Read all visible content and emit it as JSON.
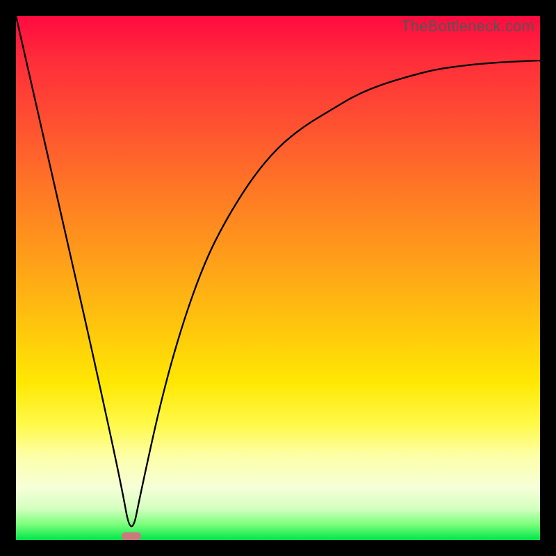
{
  "watermark": "TheBottleneck.com",
  "colors": {
    "frame": "#000000",
    "gradient_top": "#ff0a40",
    "gradient_bottom": "#00e54a",
    "curve": "#000000",
    "marker": "#cb7a7c"
  },
  "chart_data": {
    "type": "line",
    "title": "",
    "xlabel": "",
    "ylabel": "",
    "xlim": [
      0,
      100
    ],
    "ylim": [
      0,
      100
    ],
    "notes": "No axes, ticks, or labels are shown in the image; coordinates normalized 0–100 on both axes based on plot area. The curve drops from top-left to a bottom trough near x≈22, then rises with decreasing slope toward the top-right. A small rounded marker sits at the trough on the baseline.",
    "series": [
      {
        "name": "curve",
        "x": [
          0,
          5,
          10,
          15,
          20,
          22,
          24,
          28,
          32,
          36,
          40,
          45,
          50,
          55,
          60,
          65,
          70,
          75,
          80,
          85,
          90,
          95,
          100
        ],
        "y": [
          100,
          78,
          56,
          34,
          11,
          0,
          10,
          28,
          42,
          53,
          61,
          69,
          75,
          79,
          82,
          85,
          87,
          88.5,
          89.8,
          90.5,
          91,
          91.3,
          91.5
        ]
      }
    ],
    "marker": {
      "x": 22,
      "y": 0,
      "shape": "rounded-rect"
    }
  }
}
